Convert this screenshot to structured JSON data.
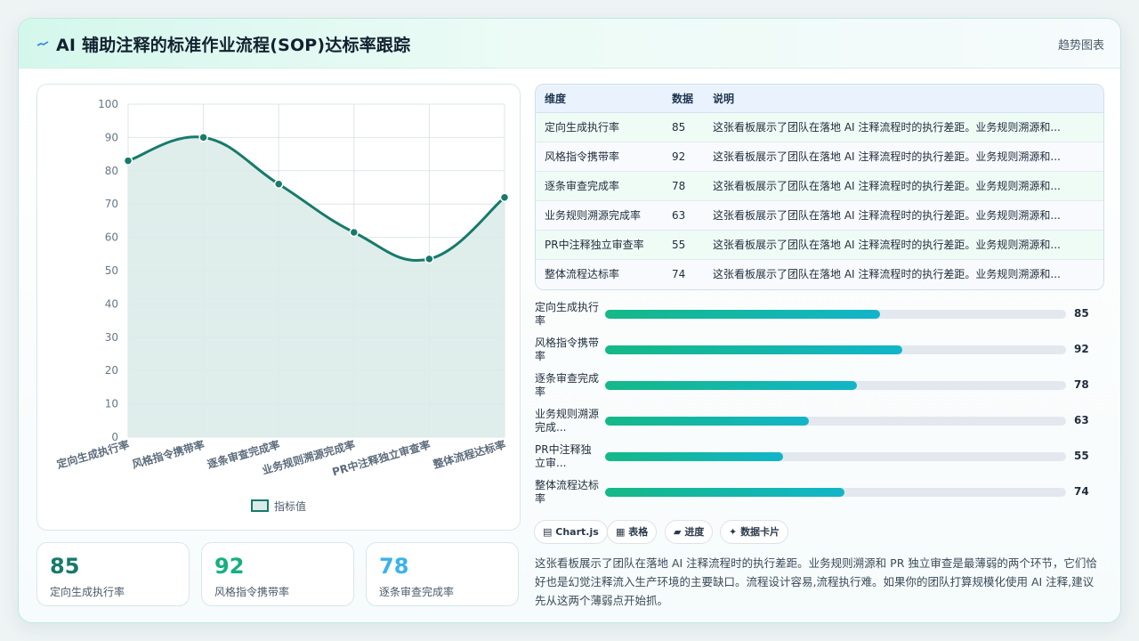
{
  "header": {
    "title": "AI 辅助注释的标准作业流程(SOP)达标率跟踪",
    "link": "趋势图表",
    "icon": "sparkline-icon"
  },
  "colors": {
    "accent": "#177a6b",
    "area": "#dbebe9",
    "kpi_1": "#177a6b",
    "kpi_2": "#16b07e",
    "kpi_3": "#3bb3e8",
    "bar_start": "#15b886",
    "bar_end": "#12b5c8"
  },
  "chart_data": {
    "type": "line",
    "categories": [
      "定向生成执行率",
      "风格指令携带率",
      "逐条审查完成率",
      "业务规则溯源完成率",
      "PR中注释独立审查率",
      "整体流程达标率"
    ],
    "series": [
      {
        "name": "指标值",
        "values": [
          83,
          90,
          76,
          61.5,
          53.5,
          72
        ]
      }
    ],
    "ylim": [
      0,
      100
    ],
    "yticks": [
      "0",
      "10",
      "20",
      "30",
      "40",
      "50",
      "60",
      "70",
      "80",
      "90",
      "100"
    ],
    "grid": true,
    "legend": "bottom",
    "fill": true,
    "smooth": true
  },
  "kpis": [
    {
      "value": "85",
      "label": "定向生成执行率"
    },
    {
      "value": "92",
      "label": "风格指令携带率"
    },
    {
      "value": "78",
      "label": "逐条审查完成率"
    }
  ],
  "table": {
    "headers": [
      "维度",
      "数据",
      "说明"
    ],
    "rows": [
      {
        "dim": "定向生成执行率",
        "value": "85",
        "desc": "这张看板展示了团队在落地 AI 注释流程时的执行差距。业务规则溯源和..."
      },
      {
        "dim": "风格指令携带率",
        "value": "92",
        "desc": "这张看板展示了团队在落地 AI 注释流程时的执行差距。业务规则溯源和..."
      },
      {
        "dim": "逐条审查完成率",
        "value": "78",
        "desc": "这张看板展示了团队在落地 AI 注释流程时的执行差距。业务规则溯源和..."
      },
      {
        "dim": "业务规则溯源完成率",
        "value": "63",
        "desc": "这张看板展示了团队在落地 AI 注释流程时的执行差距。业务规则溯源和..."
      },
      {
        "dim": "PR中注释独立审查率",
        "value": "55",
        "desc": "这张看板展示了团队在落地 AI 注释流程时的执行差距。业务规则溯源和..."
      },
      {
        "dim": "整体流程达标率",
        "value": "74",
        "desc": "这张看板展示了团队在落地 AI 注释流程时的执行差距。业务规则溯源和..."
      }
    ]
  },
  "progress": [
    {
      "line1": "定向生成执行",
      "line2": "率",
      "value": "85",
      "fill": 0.596
    },
    {
      "line1": "风格指令携带",
      "line2": "率",
      "value": "92",
      "fill": 0.645
    },
    {
      "line1": "逐条审查完成",
      "line2": "率",
      "value": "78",
      "fill": 0.547
    },
    {
      "line1": "业务规则溯源",
      "line2": "完成...",
      "value": "63",
      "fill": 0.442
    },
    {
      "line1": "PR中注释独",
      "line2": "立审...",
      "value": "55",
      "fill": 0.386
    },
    {
      "line1": "整体流程达标",
      "line2": "率",
      "value": "74",
      "fill": 0.519
    }
  ],
  "chips": [
    {
      "icon": "chart-icon",
      "glyph": "▤",
      "label": "Chart.js"
    },
    {
      "icon": "table-icon",
      "glyph": "▦",
      "label": "表格"
    },
    {
      "icon": "progress-icon",
      "glyph": "▰",
      "label": "进度"
    },
    {
      "icon": "sparkle-icon",
      "glyph": "✦",
      "label": "数据卡片"
    }
  ],
  "summary": "这张看板展示了团队在落地 AI 注释流程时的执行差距。业务规则溯源和 PR 独立审查是最薄弱的两个环节，它们恰好也是幻觉注释流入生产环境的主要缺口。流程设计容易,流程执行难。如果你的团队打算规模化使用 AI 注释,建议先从这两个薄弱点开始抓。"
}
